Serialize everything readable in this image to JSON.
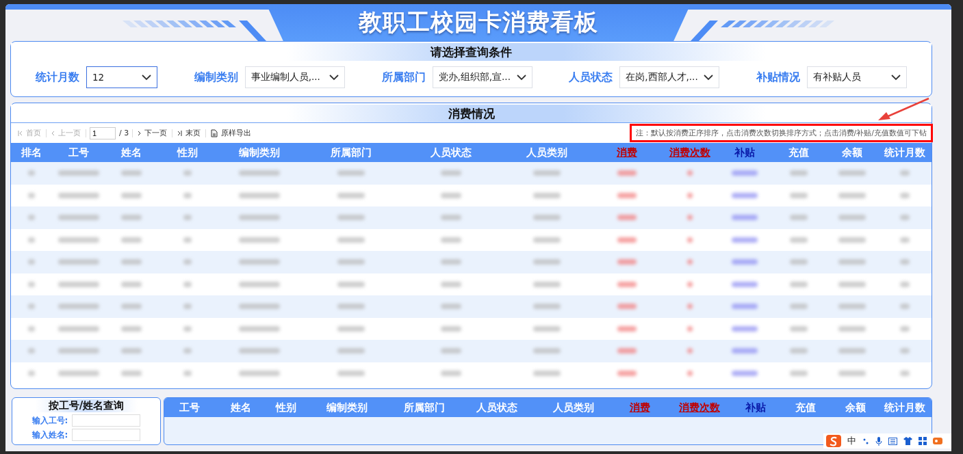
{
  "title": "教职工校园卡消费看板",
  "filters": {
    "heading": "请选择查询条件",
    "items": [
      {
        "label": "统计月数",
        "value": "12",
        "focused": true
      },
      {
        "label": "编制类别",
        "value": "事业编制人员,...",
        "focused": false
      },
      {
        "label": "所属部门",
        "value": "党办,组织部,宣...",
        "focused": false
      },
      {
        "label": "人员状态",
        "value": "在岗,西部人才,...",
        "focused": false
      },
      {
        "label": "补贴情况",
        "value": "有补贴人员",
        "focused": false
      }
    ]
  },
  "consumption": {
    "heading": "消费情况",
    "pager": {
      "first": "首页",
      "prev": "上一页",
      "page": "1",
      "total": "/ 3",
      "next": "下一页",
      "last": "末页",
      "export": "原样导出"
    },
    "note": "注：默认按消费正序排序，点击消费次数切换排序方式；点击消费/补贴/充值数值可下钻",
    "columns": [
      {
        "label": "排名",
        "kind": "plain"
      },
      {
        "label": "工号",
        "kind": "plain"
      },
      {
        "label": "姓名",
        "kind": "plain"
      },
      {
        "label": "性别",
        "kind": "plain"
      },
      {
        "label": "编制类别",
        "kind": "plain"
      },
      {
        "label": "所属部门",
        "kind": "plain"
      },
      {
        "label": "人员状态",
        "kind": "plain"
      },
      {
        "label": "人员类别",
        "kind": "plain"
      },
      {
        "label": "消费",
        "kind": "red-link"
      },
      {
        "label": "消费次数",
        "kind": "red-link"
      },
      {
        "label": "补贴",
        "kind": "blue-link"
      },
      {
        "label": "充值",
        "kind": "plain"
      },
      {
        "label": "余额",
        "kind": "plain"
      },
      {
        "label": "统计月数",
        "kind": "plain"
      }
    ],
    "rows": [
      {
        "kind": "blurred"
      },
      {
        "kind": "blurred"
      },
      {
        "kind": "blurred"
      },
      {
        "kind": "blurred"
      },
      {
        "kind": "blurred"
      },
      {
        "kind": "blurred"
      },
      {
        "kind": "blurred"
      },
      {
        "kind": "blurred"
      },
      {
        "kind": "blurred"
      },
      {
        "kind": "blurred"
      }
    ]
  },
  "lookup": {
    "heading": "按工号/姓名查询",
    "fields": [
      {
        "label": "输入工号:"
      },
      {
        "label": "输入姓名:"
      }
    ],
    "columns": [
      {
        "label": "工号",
        "kind": "plain"
      },
      {
        "label": "姓名",
        "kind": "plain"
      },
      {
        "label": "性别",
        "kind": "plain"
      },
      {
        "label": "编制类别",
        "kind": "plain"
      },
      {
        "label": "所属部门",
        "kind": "plain"
      },
      {
        "label": "人员状态",
        "kind": "plain"
      },
      {
        "label": "人员类别",
        "kind": "plain"
      },
      {
        "label": "消费",
        "kind": "red-link"
      },
      {
        "label": "消费次数",
        "kind": "red-link"
      },
      {
        "label": "补贴",
        "kind": "blue-link"
      },
      {
        "label": "充值",
        "kind": "plain"
      },
      {
        "label": "余额",
        "kind": "plain"
      },
      {
        "label": "统计月数",
        "kind": "plain"
      }
    ]
  },
  "ime": {
    "mode": "中"
  }
}
